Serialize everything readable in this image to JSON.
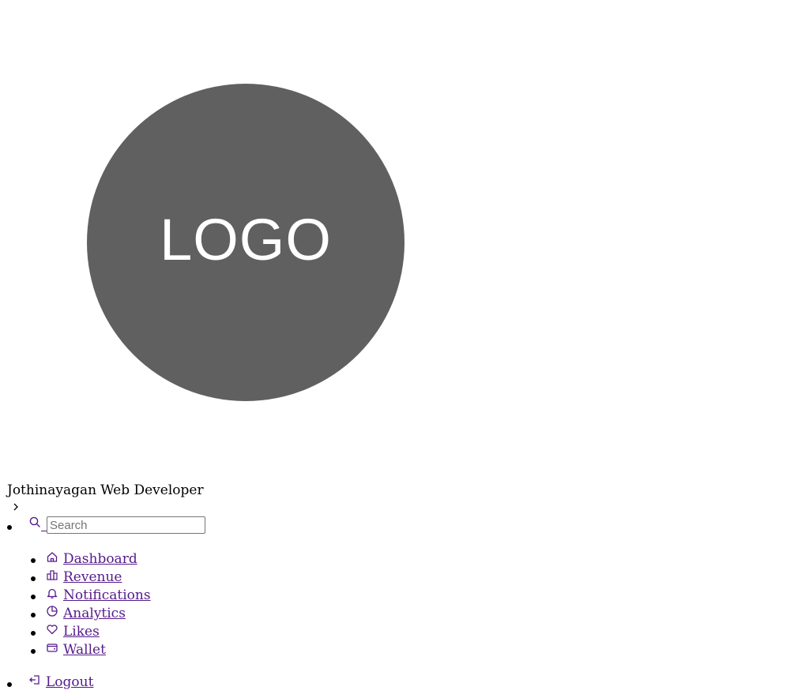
{
  "logo": {
    "text": "LOGO",
    "bg_color": "#606060",
    "text_color": "#ffffff"
  },
  "profile": {
    "name": "Jothinayagan",
    "title": "Web Developer"
  },
  "toggle": {
    "icon": "chevron-right-icon"
  },
  "search": {
    "icon": "search-icon",
    "placeholder": "Search",
    "value": ""
  },
  "menu": {
    "link_color": "#551a8b",
    "items": [
      {
        "label": "Dashboard",
        "icon": "home-icon"
      },
      {
        "label": "Revenue",
        "icon": "bar-chart-icon"
      },
      {
        "label": "Notifications",
        "icon": "bell-icon"
      },
      {
        "label": "Analytics",
        "icon": "pie-chart-icon"
      },
      {
        "label": "Likes",
        "icon": "heart-icon"
      },
      {
        "label": "Wallet",
        "icon": "wallet-icon"
      }
    ]
  },
  "logout": {
    "label": "Logout",
    "icon": "logout-icon"
  }
}
